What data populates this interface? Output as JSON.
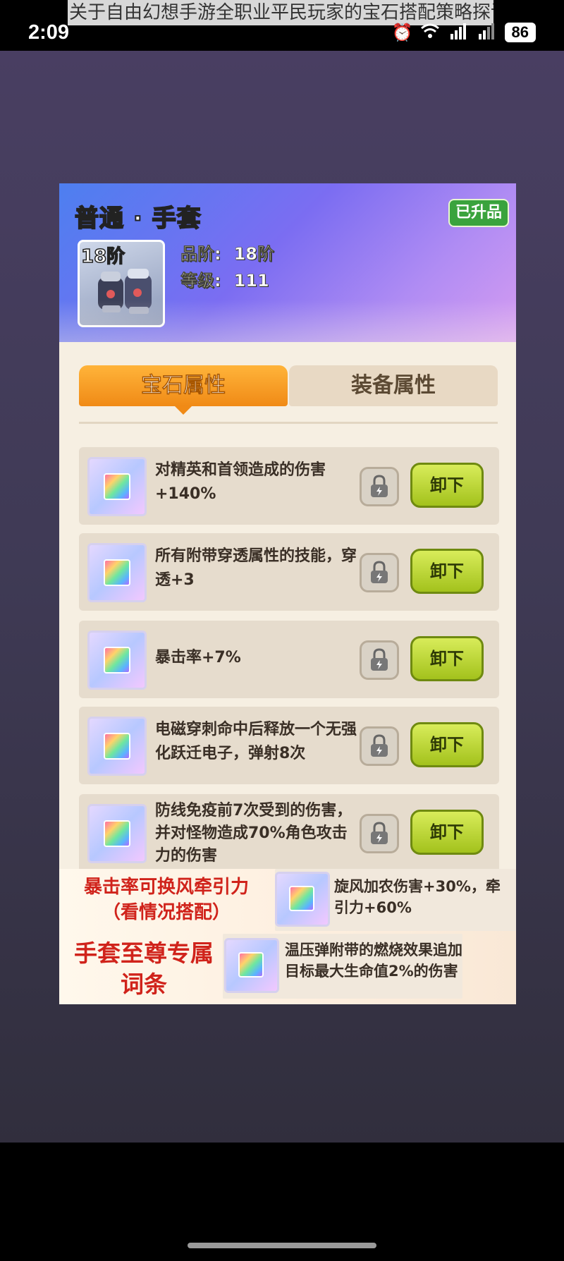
{
  "status_bar": {
    "time": "2:09",
    "page_title": "关于自由幻想手游全职业平民玩家的宝石搭配策略探讨",
    "battery": "86",
    "icons": [
      "alarm-icon",
      "wifi-icon",
      "signal-5g-icon",
      "signal-icon"
    ]
  },
  "equipment": {
    "title": "普通 · 手套",
    "badge": "已升品",
    "tier_label": "18阶",
    "stats": [
      {
        "label": "品阶:",
        "value": "18阶"
      },
      {
        "label": "等级:",
        "value": "111"
      }
    ]
  },
  "tabs": [
    {
      "label": "宝石属性",
      "active": true
    },
    {
      "label": "装备属性",
      "active": false
    }
  ],
  "gems": [
    {
      "text": "对精英和首领造成的伤害+140%",
      "button": "卸下"
    },
    {
      "text": "所有附带穿透属性的技能，穿透+3",
      "button": "卸下"
    },
    {
      "text": "暴击率+7%",
      "button": "卸下"
    },
    {
      "text": "电磁穿刺命中后释放一个无强化跃迁电子，弹射8次",
      "button": "卸下"
    },
    {
      "text": "防线免疫前7次受到的伤害，并对怪物造成70%角色攻击力的伤害",
      "button": "卸下"
    }
  ],
  "notes": {
    "note_a": "暴击率可换风牵引力（看情况搭配）",
    "note_b": "手套至尊专属词条",
    "alt_gem_a": "旋风加农伤害+30%，牵引力+60%",
    "alt_gem_b": "温压弹附带的燃烧效果追加目标最大生命值2%的伤害"
  },
  "colors": {
    "accent_orange": "#f08a16",
    "button_green": "#a3c21c",
    "badge_green": "#3aa33d",
    "note_red": "#d0231b"
  }
}
